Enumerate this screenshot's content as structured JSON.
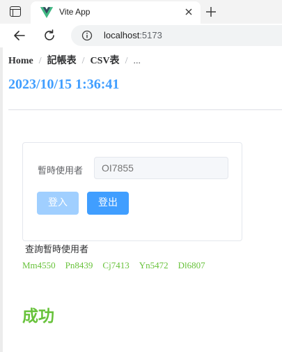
{
  "browser": {
    "tab_title": "Vite App",
    "url_host": "localhost",
    "url_port": ":5173",
    "colors": {
      "vue_green": "#41b883",
      "vue_dark": "#34495e"
    },
    "icons": [
      "window-icon",
      "vue-logo-icon",
      "close-icon",
      "plus-icon",
      "back-arrow-icon",
      "reload-icon",
      "info-icon"
    ]
  },
  "breadcrumb": {
    "items": [
      "Home",
      "記帳表",
      "CSV表",
      "..."
    ],
    "separator": "/"
  },
  "datetime": "2023/10/15 1:36:41",
  "form": {
    "label": "暫時使用者",
    "input_placeholder": "OI7855",
    "login_label": "登入",
    "logout_label": "登出"
  },
  "query": {
    "title": "查詢暫時使用者",
    "users": [
      "Mm4550",
      "Pn8439",
      "Cj7413",
      "Yn5472",
      "Dl6807"
    ]
  },
  "status": "成功",
  "colors": {
    "primary": "#409eff",
    "primary_disabled": "#a0cfff",
    "success": "#67c23a"
  }
}
